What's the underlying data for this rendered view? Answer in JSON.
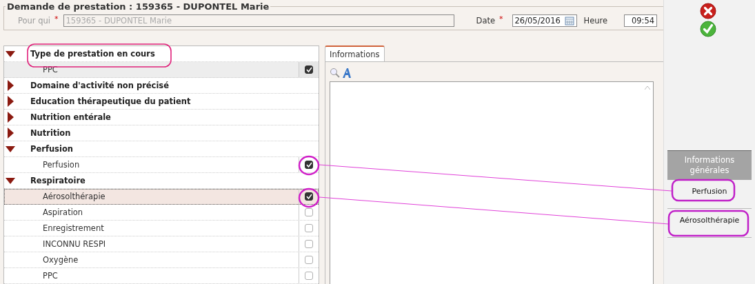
{
  "dialog": {
    "title": "Demande de prestation : 159365 - DUPONTEL Marie",
    "pour_qui": {
      "label": "Pour qui",
      "required_mark": "*",
      "value": "159365 - DUPONTEL Marie",
      "disabled": true
    },
    "date": {
      "label": "Date",
      "required_mark": "*",
      "value": "26/05/2016"
    },
    "heure": {
      "label": "Heure",
      "value": "09:54"
    }
  },
  "tree": [
    {
      "label": "Type de prestation en cours",
      "expanded": true,
      "children": [
        {
          "label": "PPC",
          "checked": true,
          "selected": false,
          "hovered": true
        }
      ]
    },
    {
      "label": "Domaine d'activité non précisé",
      "expanded": false
    },
    {
      "label": "Education thérapeutique du patient",
      "expanded": false
    },
    {
      "label": "Nutrition entérale",
      "expanded": false
    },
    {
      "label": "Nutrition",
      "expanded": false
    },
    {
      "label": "Perfusion",
      "expanded": true,
      "children": [
        {
          "label": "Perfusion",
          "checked": true,
          "selected": false,
          "hovered": false
        }
      ]
    },
    {
      "label": "Respiratoire",
      "expanded": true,
      "children": [
        {
          "label": "Aérosolthérapie",
          "checked": true,
          "selected": true,
          "hovered": false
        },
        {
          "label": "Aspiration",
          "checked": false,
          "selected": false,
          "hovered": false
        },
        {
          "label": "Enregistrement",
          "checked": false,
          "selected": false,
          "hovered": false
        },
        {
          "label": "INCONNU RESPI",
          "checked": false,
          "selected": false,
          "hovered": false
        },
        {
          "label": "Oxygène",
          "checked": false,
          "selected": false,
          "hovered": false
        },
        {
          "label": "PPC",
          "checked": false,
          "selected": false,
          "hovered": false
        }
      ]
    }
  ],
  "tabs": [
    {
      "label": "Informations",
      "selected": true
    }
  ],
  "sidebar": {
    "header": "Informations générales",
    "items": [
      "Perfusion",
      "Aérosolthérapie"
    ]
  }
}
